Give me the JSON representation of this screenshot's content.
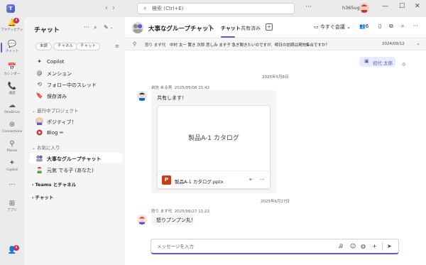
{
  "titlebar": {
    "search_placeholder": "検索 (Ctrl+E)",
    "user": "h365ug",
    "back_icon": "‹",
    "forward_icon": "›",
    "more": "···",
    "min": "—",
    "max": "☐",
    "close": "✕"
  },
  "rail": [
    {
      "label": "アクティビティ",
      "icon": "🔔",
      "badge": "4"
    },
    {
      "label": "チャット",
      "icon": "💬",
      "active": true
    },
    {
      "label": "カレンダー",
      "icon": "📅"
    },
    {
      "label": "通話",
      "icon": "📞"
    },
    {
      "label": "OneDrive",
      "icon": "☁"
    },
    {
      "label": "Connections",
      "icon": "⊛"
    },
    {
      "label": "Places",
      "icon": "⚲"
    },
    {
      "label": "Copilot",
      "icon": "✦"
    },
    {
      "label": "",
      "icon": "···"
    },
    {
      "label": "アプリ",
      "icon": "⊞"
    }
  ],
  "rail_bottom_badge": "4",
  "chatlist": {
    "title": "チャット",
    "filters": [
      "未読",
      "チャネル",
      "チャット"
    ],
    "quick": [
      {
        "label": "Copilot",
        "icon": "✦"
      },
      {
        "label": "メンション",
        "icon": "@"
      },
      {
        "label": "フォロー中のスレッド",
        "icon": "⟲"
      },
      {
        "label": "保存済み",
        "icon": "🔖"
      }
    ],
    "section_projects": "進行中プロジェクト",
    "projects": [
      {
        "label": "ポジティブ！"
      },
      {
        "label": "Blog ✏"
      }
    ],
    "section_favorites": "お気に入り",
    "favorites": [
      {
        "label": "大事なグループチャット"
      },
      {
        "label": "元気 でる子 (あなた)"
      }
    ],
    "section_teams": "Teams とチャネル",
    "section_chat": "チャット"
  },
  "header": {
    "title": "大事なグループチャット",
    "tabs": [
      "チャット",
      "共有済み"
    ],
    "meet": "今すぐ会議",
    "people_count": "6"
  },
  "pinned": {
    "author": "怒り まず代",
    "text": "中村 太一 驚き 次郎 悲しみ ます子 急ぎ聞きたいのですが、明日の訪問は現地集合ですか？",
    "date": "2024/09/12"
  },
  "my_message": {
    "text": "初代 太郎"
  },
  "messages": [
    {
      "date_sep": "2025年5月8日",
      "author": "自信 ある男",
      "time": "2025/05/08 15:42",
      "text": "共有します！",
      "file": {
        "preview": "製品A-1 カタログ",
        "name": "製品A-1 カタログ.pptx",
        "type": "P"
      }
    },
    {
      "date_sep": "2025年6月27日",
      "author": "怒り まず代",
      "time": "2025/06/27 11:22",
      "text": "怒りプンプン丸！"
    }
  ],
  "compose": {
    "placeholder": "メッセージを入力"
  },
  "colors": {
    "accent": "#5b5fc7",
    "badge": "#c4314b",
    "ppt": "#c43e1c"
  }
}
